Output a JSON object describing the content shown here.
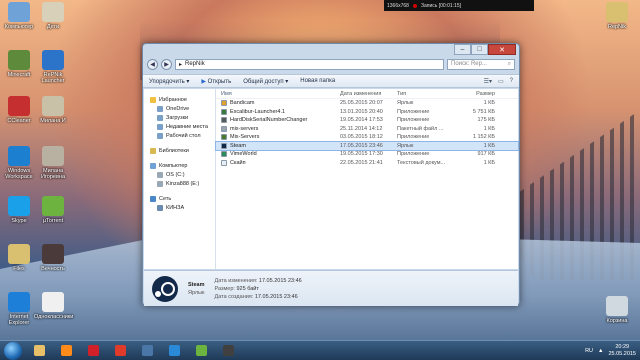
{
  "recorder": {
    "resolution": "1366x768",
    "recording": "Запись [00:01:15]"
  },
  "desktop_icons": [
    {
      "label": "Компьютер",
      "color": "#6fa3d8"
    },
    {
      "label": "Дети",
      "color": "#d8d0b8"
    },
    {
      "label": "Minecraft",
      "color": "#5e8a3b"
    },
    {
      "label": "RePNik Launcher",
      "color": "#2c74c9"
    },
    {
      "label": "CCleaner",
      "color": "#c62f2f"
    },
    {
      "label": "Милана И",
      "color": "#c9c0a8"
    },
    {
      "label": "Windows Workspace",
      "color": "#1c7fd0"
    },
    {
      "label": "Милана Игоревна",
      "color": "#b8b0a0"
    },
    {
      "label": "Skype",
      "color": "#1aa0e8"
    },
    {
      "label": "µTorrent",
      "color": "#6db33f"
    },
    {
      "label": "Files",
      "color": "#d8c070"
    },
    {
      "label": "Вечность",
      "color": "#4a3a3a"
    },
    {
      "label": "Internet Explorer",
      "color": "#1e7fd8"
    },
    {
      "label": "Одноклассники",
      "color": "#f0f0f0"
    },
    {
      "label": "RepNik",
      "color": "#d8c070"
    },
    {
      "label": "Корзина",
      "color": "#d0d8e0"
    }
  ],
  "window": {
    "breadcrumb": "RepNik",
    "search_placeholder": "Поиск: Rep...",
    "toolbar": {
      "organize": "Упорядочить ▾",
      "open": "Открыть",
      "share": "Общий доступ ▾",
      "new_folder": "Новая папка"
    },
    "nav": {
      "favorites": "Избранное",
      "favorites_items": [
        "OneDrive",
        "Загрузки",
        "Недавние места",
        "Рабочий стол"
      ],
      "libraries": "Библиотеки",
      "computer": "Компьютер",
      "computer_items": [
        "OS (C:)",
        "Kinza888 (E:)"
      ],
      "network": "Сеть",
      "network_items": [
        "КИНЗА"
      ]
    },
    "columns": {
      "name": "Имя",
      "date": "Дата изменения",
      "type": "Тип",
      "size": "Размер"
    },
    "files": [
      {
        "name": "Bandicam",
        "date": "25.05.2015 20:07",
        "type": "Ярлык",
        "size": "1 КБ",
        "icon_color": "#e0a030"
      },
      {
        "name": "Excalibur-Launcher4.1",
        "date": "13.01.2015 20:40",
        "type": "Приложение",
        "size": "5 751 КБ",
        "icon_color": "#3b7a3b"
      },
      {
        "name": "HardDiskSerialNumberChanger",
        "date": "19.05.2014 17:53",
        "type": "Приложение",
        "size": "175 КБ",
        "icon_color": "#5a5a5a"
      },
      {
        "name": "mix-servers",
        "date": "25.11.2014 14:12",
        "type": "Пакетный файл ...",
        "size": "1 КБ",
        "icon_color": "#9aa4ae"
      },
      {
        "name": "Mix-Servers",
        "date": "03.05.2015 18:12",
        "type": "Приложение",
        "size": "1 152 КБ",
        "icon_color": "#4a7a2a"
      },
      {
        "name": "Steam",
        "date": "17.05.2015 23:46",
        "type": "Ярлык",
        "size": "1 КБ",
        "icon_color": "#13294a"
      },
      {
        "name": "VimeWorld",
        "date": "19.05.2015 17:30",
        "type": "Приложение",
        "size": "917 КБ",
        "icon_color": "#2e8b57"
      },
      {
        "name": "Скайп",
        "date": "22.05.2015 21:41",
        "type": "Текстовый докум...",
        "size": "1 КБ",
        "icon_color": "#e8eef4"
      }
    ],
    "selected_index": 5,
    "details": {
      "name": "Steam",
      "type": "Ярлык",
      "modified_label": "Дата изменения:",
      "modified": "17.05.2015 23:46",
      "size_label": "Размер:",
      "size": "925 байт",
      "created_label": "Дата создания:",
      "created": "17.05.2015 23:46"
    }
  },
  "taskbar": {
    "apps": [
      {
        "name": "explorer",
        "color": "#e8c06a"
      },
      {
        "name": "media-player",
        "color": "#ff8c1a"
      },
      {
        "name": "opera",
        "color": "#d0202a"
      },
      {
        "name": "yandex",
        "color": "#e03a2a"
      },
      {
        "name": "vk",
        "color": "#4a76a8"
      },
      {
        "name": "ie",
        "color": "#2a8ad8"
      },
      {
        "name": "utorrent",
        "color": "#6db33f"
      },
      {
        "name": "media",
        "color": "#404040"
      }
    ],
    "language": "RU",
    "time": "20:29",
    "date": "25.05.2015"
  }
}
